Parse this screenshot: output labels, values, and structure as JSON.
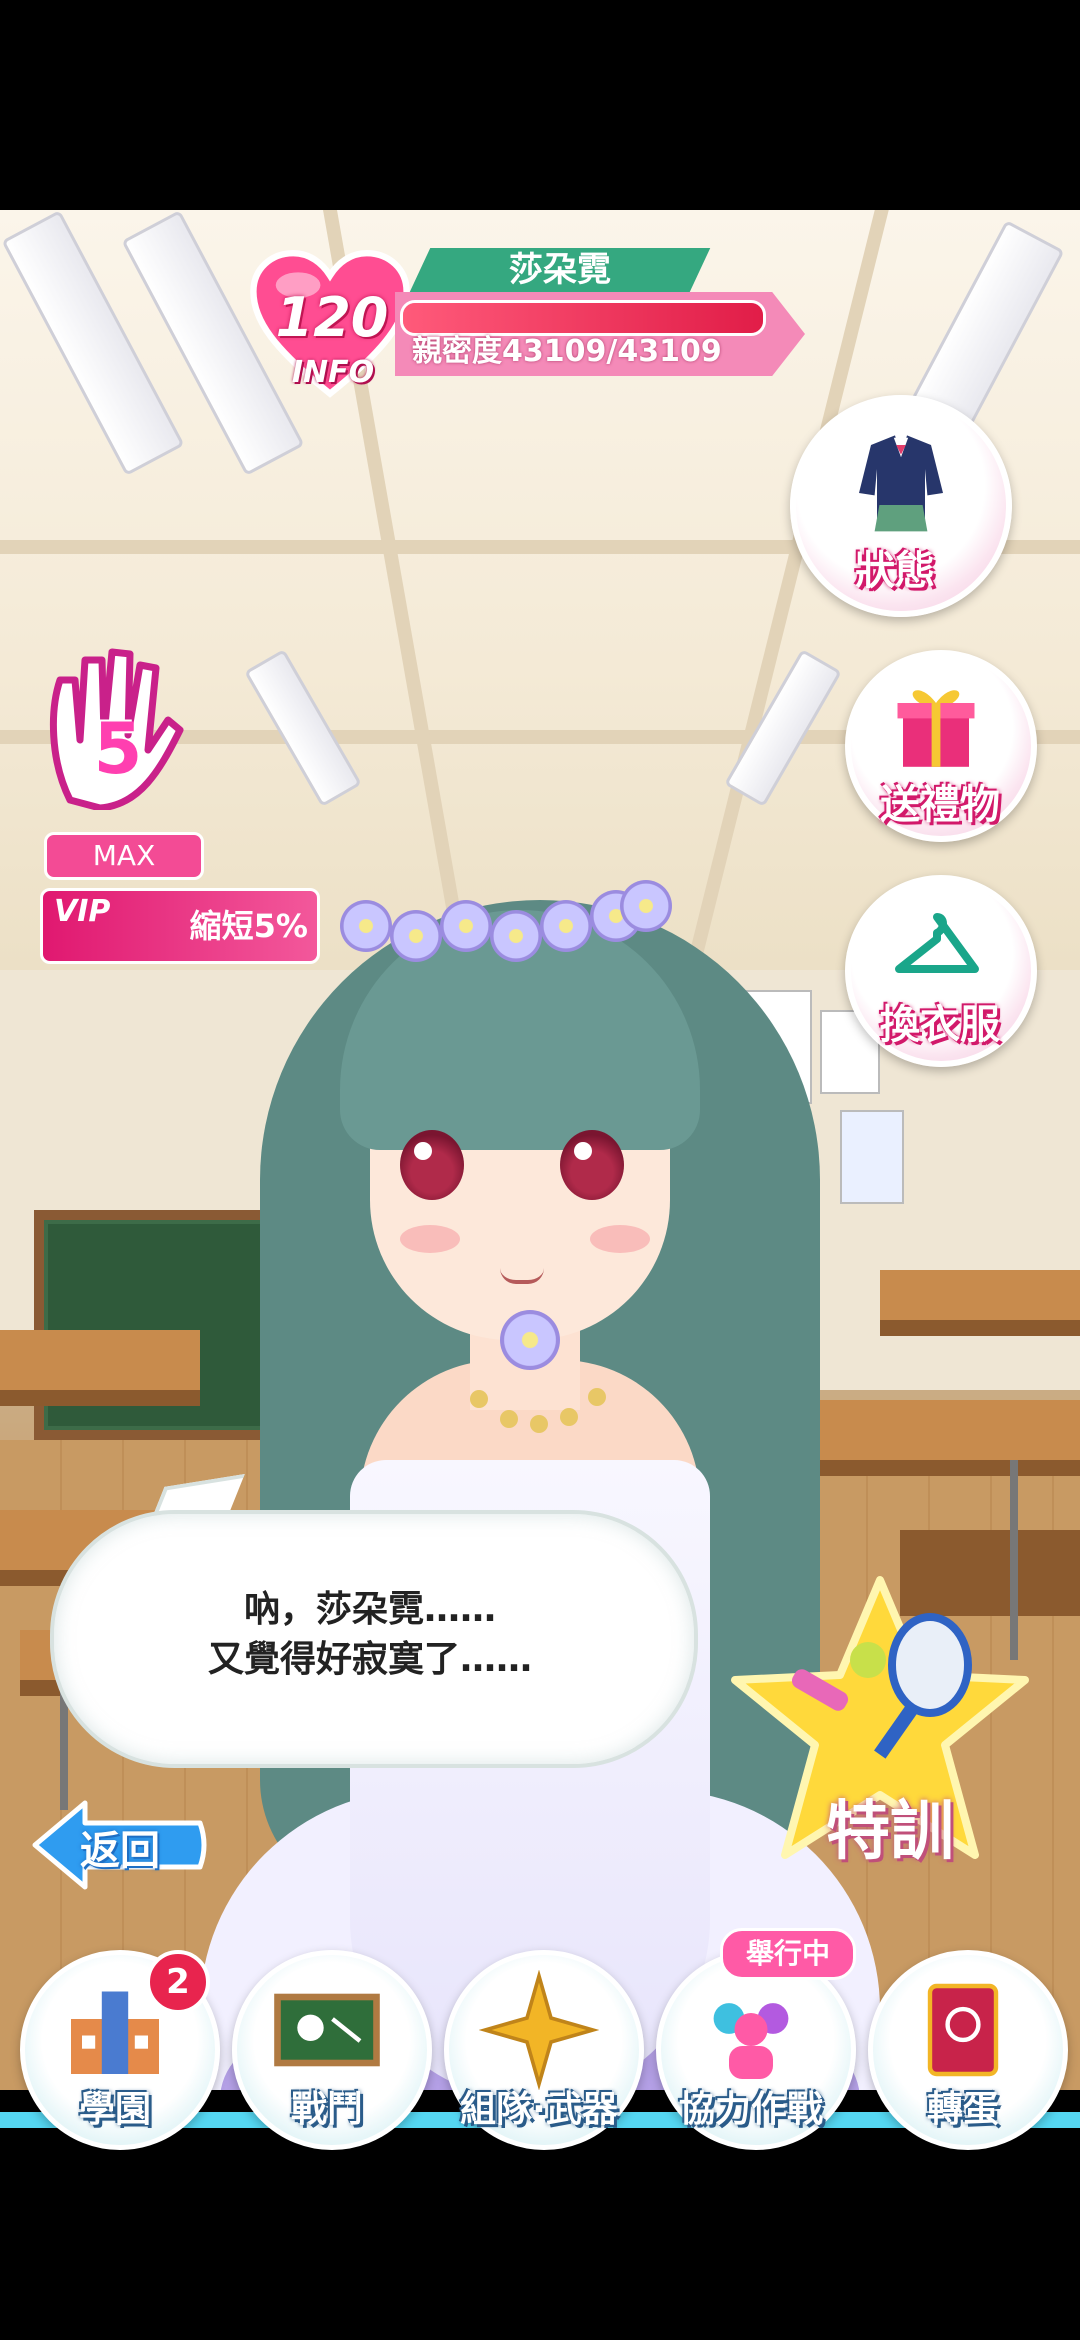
{
  "character": {
    "name": "莎朶霓",
    "affection_level": "120",
    "info_label": "INFO",
    "affection_text": "親密度43109/43109",
    "affection_progress": 1.0
  },
  "status": {
    "hand_count": "5",
    "max_label": "MAX",
    "vip_label": "VIP",
    "vip_value": "縮短5%"
  },
  "side_menu": {
    "status_label": "狀態",
    "gift_label": "送禮物",
    "wardrobe_label": "換衣服"
  },
  "dialogue": {
    "line1": "吶，莎朶霓……",
    "line2": "又覺得好寂寞了……"
  },
  "actions": {
    "back_label": "返回",
    "training_label": "特訓"
  },
  "bottom_nav": {
    "items": [
      {
        "label": "學園",
        "badge": "2"
      },
      {
        "label": "戰鬥"
      },
      {
        "label": "組隊·武器"
      },
      {
        "label": "協力作戰",
        "tag": "舉行中"
      },
      {
        "label": "轉蛋"
      }
    ]
  },
  "icons": {
    "heart": "heart-icon",
    "hand": "hand-icon",
    "uniform": "uniform-icon",
    "gift": "gift-box-icon",
    "hanger": "hanger-icon",
    "training": "dumbbell-tennis-icon"
  },
  "colors": {
    "accent_pink": "#f34b95",
    "name_green": "#35a880",
    "nav_cyan": "#55d7f2"
  }
}
